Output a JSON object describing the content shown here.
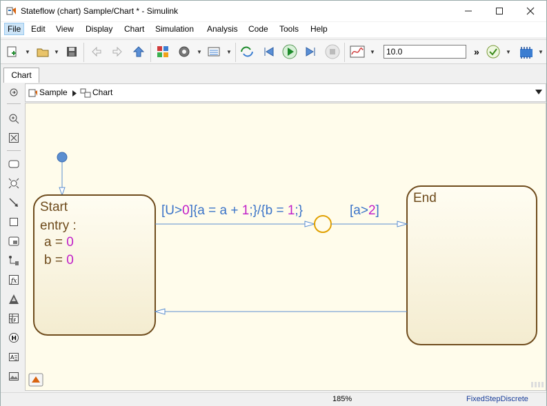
{
  "window": {
    "title": "Stateflow (chart) Sample/Chart * - Simulink",
    "minimize_icon": "minimize-icon",
    "maximize_icon": "maximize-icon",
    "close_icon": "close-icon"
  },
  "menu": {
    "items": [
      "File",
      "Edit",
      "View",
      "Display",
      "Chart",
      "Simulation",
      "Analysis",
      "Code",
      "Tools",
      "Help"
    ],
    "selected": "File"
  },
  "toolbar": {
    "stop_time": "10.0",
    "more_label": "»",
    "icons": [
      "new-model-icon",
      "open-icon",
      "save-icon",
      "back-icon",
      "forward-icon",
      "up-icon",
      "library-browser-icon",
      "model-config-icon",
      "model-explorer-icon",
      "step-back-icon",
      "step-back-icon",
      "run-icon",
      "step-forward-icon",
      "stop-icon",
      "data-inspector-icon",
      "model-advisor-icon",
      "build-icon"
    ]
  },
  "tabs": [
    "Chart"
  ],
  "breadcrumb": {
    "items": [
      "Sample",
      "Chart"
    ]
  },
  "palette": {
    "tools": [
      "hide-show-icon",
      "zoom-in-icon",
      "fit-view-icon",
      "state-tool-icon",
      "junction-tool-icon",
      "transition-tool-icon",
      "box-tool-icon",
      "subchart-tool-icon",
      "default-transition-icon",
      "function-tool-icon",
      "simulink-function-icon",
      "truth-table-icon",
      "history-junction-icon",
      "annotation-icon",
      "image-icon"
    ]
  },
  "chart": {
    "states": {
      "start": {
        "name": "Start",
        "entry": "entry :",
        "a_prefix": "a = ",
        "a_val": "0",
        "b_prefix": "b = ",
        "b_val": "0"
      },
      "end": {
        "name": "End"
      }
    },
    "transition1": {
      "p1": "[U>",
      "n1": "0",
      "p2": "]{a = a + ",
      "n2": "1",
      "p3": ";}/{b = ",
      "n3": "1",
      "p4": ";}"
    },
    "transition2": {
      "p1": "[a>",
      "n1": "2",
      "p2": "]"
    },
    "colors": {
      "state_border": "#6e4b1c",
      "state_fill": "#fdf9e8",
      "transition": "#5b8ed0",
      "label": "#3a73c8",
      "number": "#c01ec8",
      "junction": "#e0a000",
      "canvas": "#fffceb"
    }
  },
  "status": {
    "zoom": "185%",
    "solver": "FixedStepDiscrete"
  }
}
